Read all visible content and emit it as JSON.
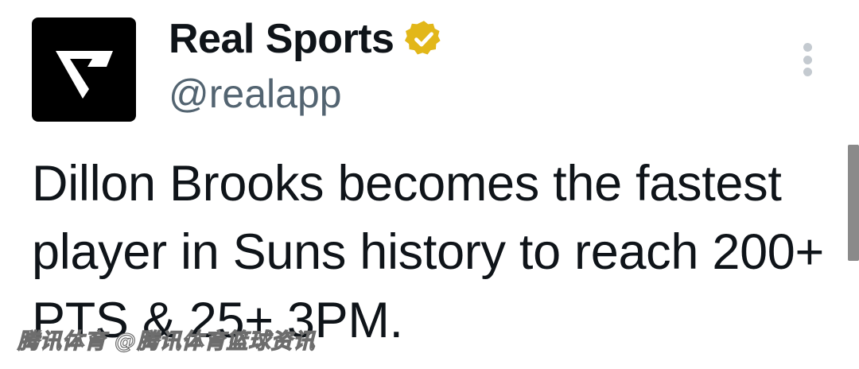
{
  "account": {
    "display_name": "Real Sports",
    "handle": "@realapp",
    "verified": true,
    "verified_badge_color": "#e2b719",
    "avatar_logo": "real-sports-logo"
  },
  "tweet": {
    "text": "Dillon Brooks becomes the fastest player in Suns history to reach 200+ PTS & 25+ 3PM."
  },
  "menu": {
    "icon": "more-vertical-icon"
  },
  "watermark": {
    "text": "腾讯体育 @腾讯体育篮球资讯"
  },
  "colors": {
    "text_primary": "#0f1419",
    "text_secondary": "#536471",
    "avatar_bg": "#000000"
  }
}
